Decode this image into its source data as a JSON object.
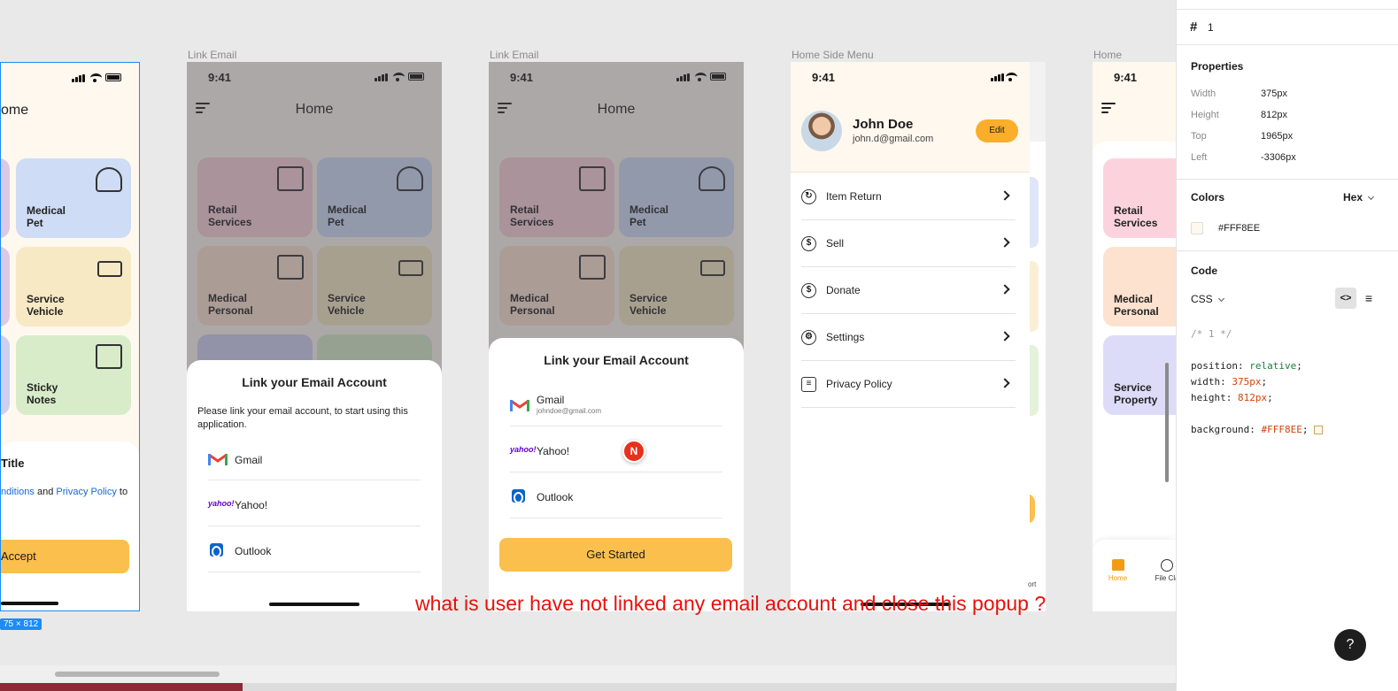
{
  "frames": [
    {
      "label": "Link Email"
    },
    {
      "label": "Link Email"
    },
    {
      "label": "Home Side Menu"
    },
    {
      "label": "Home"
    }
  ],
  "status_time": "9:41",
  "home_title": "Home",
  "tiles": {
    "retail": "Retail Services",
    "medical_pet": "Medical Pet",
    "medical_personal": "Medical Personal",
    "service_vehicle": "Service Vehicle",
    "sticky_notes": "Sticky Notes",
    "service_property": "Service Property"
  },
  "frame1": {
    "home_partial": "ome",
    "terms_title": "Title",
    "terms_text_a": "nditions",
    "terms_text_b": " and ",
    "terms_text_c": "Privacy Policy",
    "terms_text_d": " to",
    "accept_label": "Accept",
    "size_badge": "75 × 812"
  },
  "link_sheet": {
    "title": "Link your Email Account",
    "description": "Please link your email account, to start using this application.",
    "gmail": "Gmail",
    "gmail_email": "johndoe@gmail.com",
    "yahoo": "Yahoo!",
    "yahoo_logo": "yahoo!",
    "outlook": "Outlook",
    "get_started": "Get Started"
  },
  "cursor_avatar": "N",
  "side_menu": {
    "user_name": "John Doe",
    "user_email": "john.d@gmail.com",
    "edit_label": "Edit",
    "items": [
      {
        "label": "Item Return"
      },
      {
        "label": "Sell"
      },
      {
        "label": "Donate"
      },
      {
        "label": "Settings"
      },
      {
        "label": "Privacy Policy"
      }
    ],
    "partial_text": "ort"
  },
  "home_nav": {
    "home": "Home",
    "file_claim": "File Cla"
  },
  "annotation": "what is user have not linked any email account and close this popup ?",
  "inspector": {
    "layer_name": "1",
    "properties_title": "Properties",
    "props": [
      {
        "key": "Width",
        "value": "375px"
      },
      {
        "key": "Height",
        "value": "812px"
      },
      {
        "key": "Top",
        "value": "1965px"
      },
      {
        "key": "Left",
        "value": "-3306px"
      }
    ],
    "colors_title": "Colors",
    "color_format": "Hex",
    "color_value": "#FFF8EE",
    "code_title": "Code",
    "code_lang": "CSS",
    "code_comment": "/* 1 */",
    "code_lines": [
      {
        "prop": "position: ",
        "val": "relative"
      },
      {
        "prop": "width: ",
        "val": "375px"
      },
      {
        "prop": "height: ",
        "val": "812px"
      },
      {
        "prop": "background: ",
        "val": "#FFF8EE"
      }
    ],
    "help": "?"
  },
  "colors": {
    "accent": "#fbbf4d",
    "annotation": "#e8100c",
    "selection": "#1b8cf5",
    "bg": "#FFF8EE"
  }
}
